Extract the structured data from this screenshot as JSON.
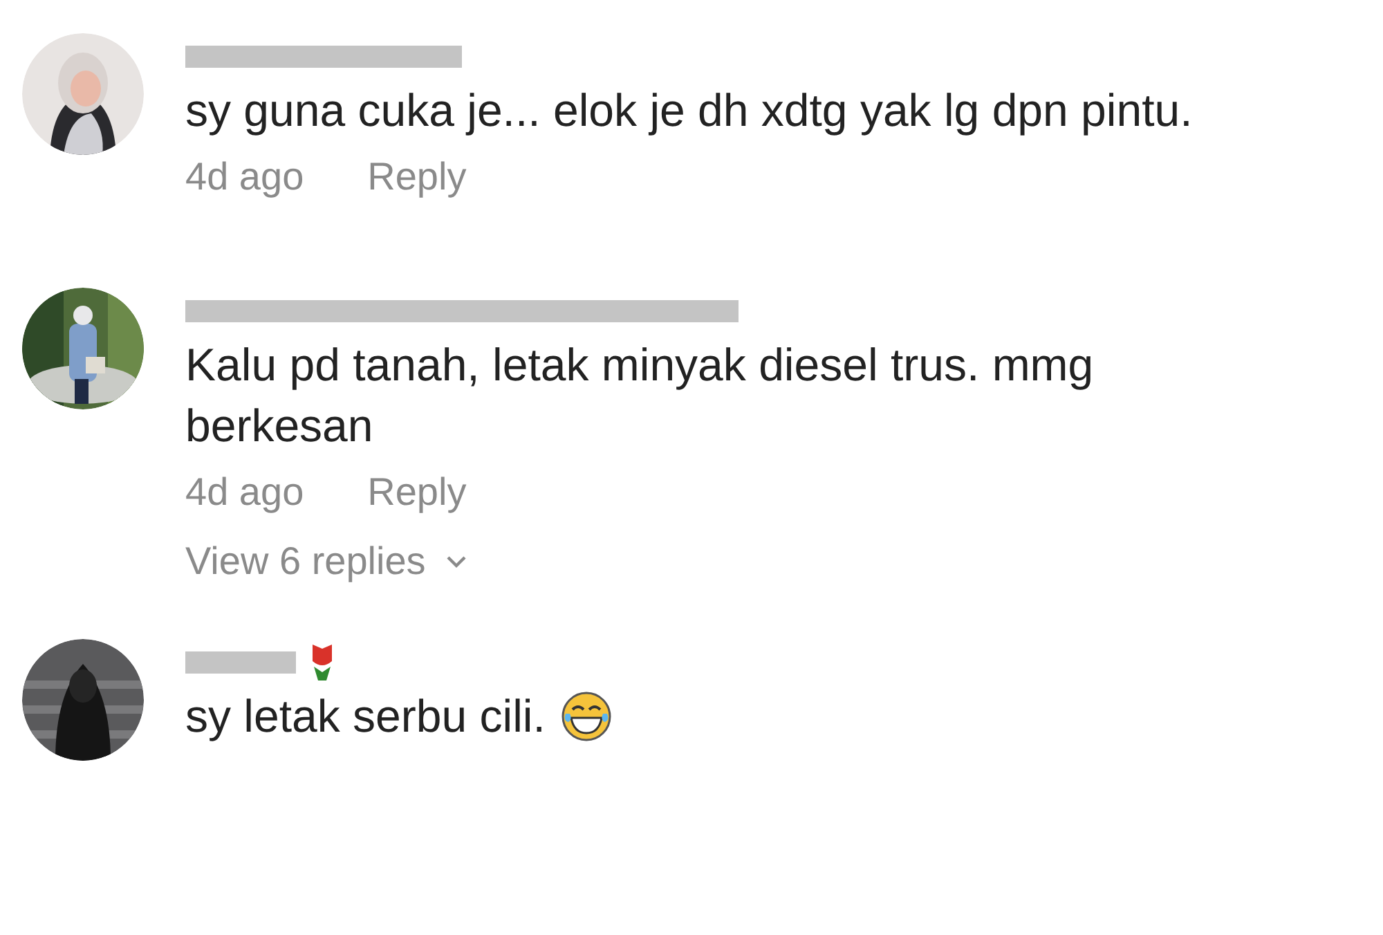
{
  "comments": [
    {
      "text": "sy guna cuka je... elok je dh xdtg yak lg dpn pintu.",
      "time": "4d ago",
      "reply": "Reply"
    },
    {
      "text": "Kalu pd tanah, letak minyak diesel trus. mmg berkesan",
      "time": "4d ago",
      "reply": "Reply",
      "view_replies": "View 6 replies"
    },
    {
      "text": "sy letak serbu cili.",
      "name_badge": true,
      "emoji": true
    }
  ]
}
